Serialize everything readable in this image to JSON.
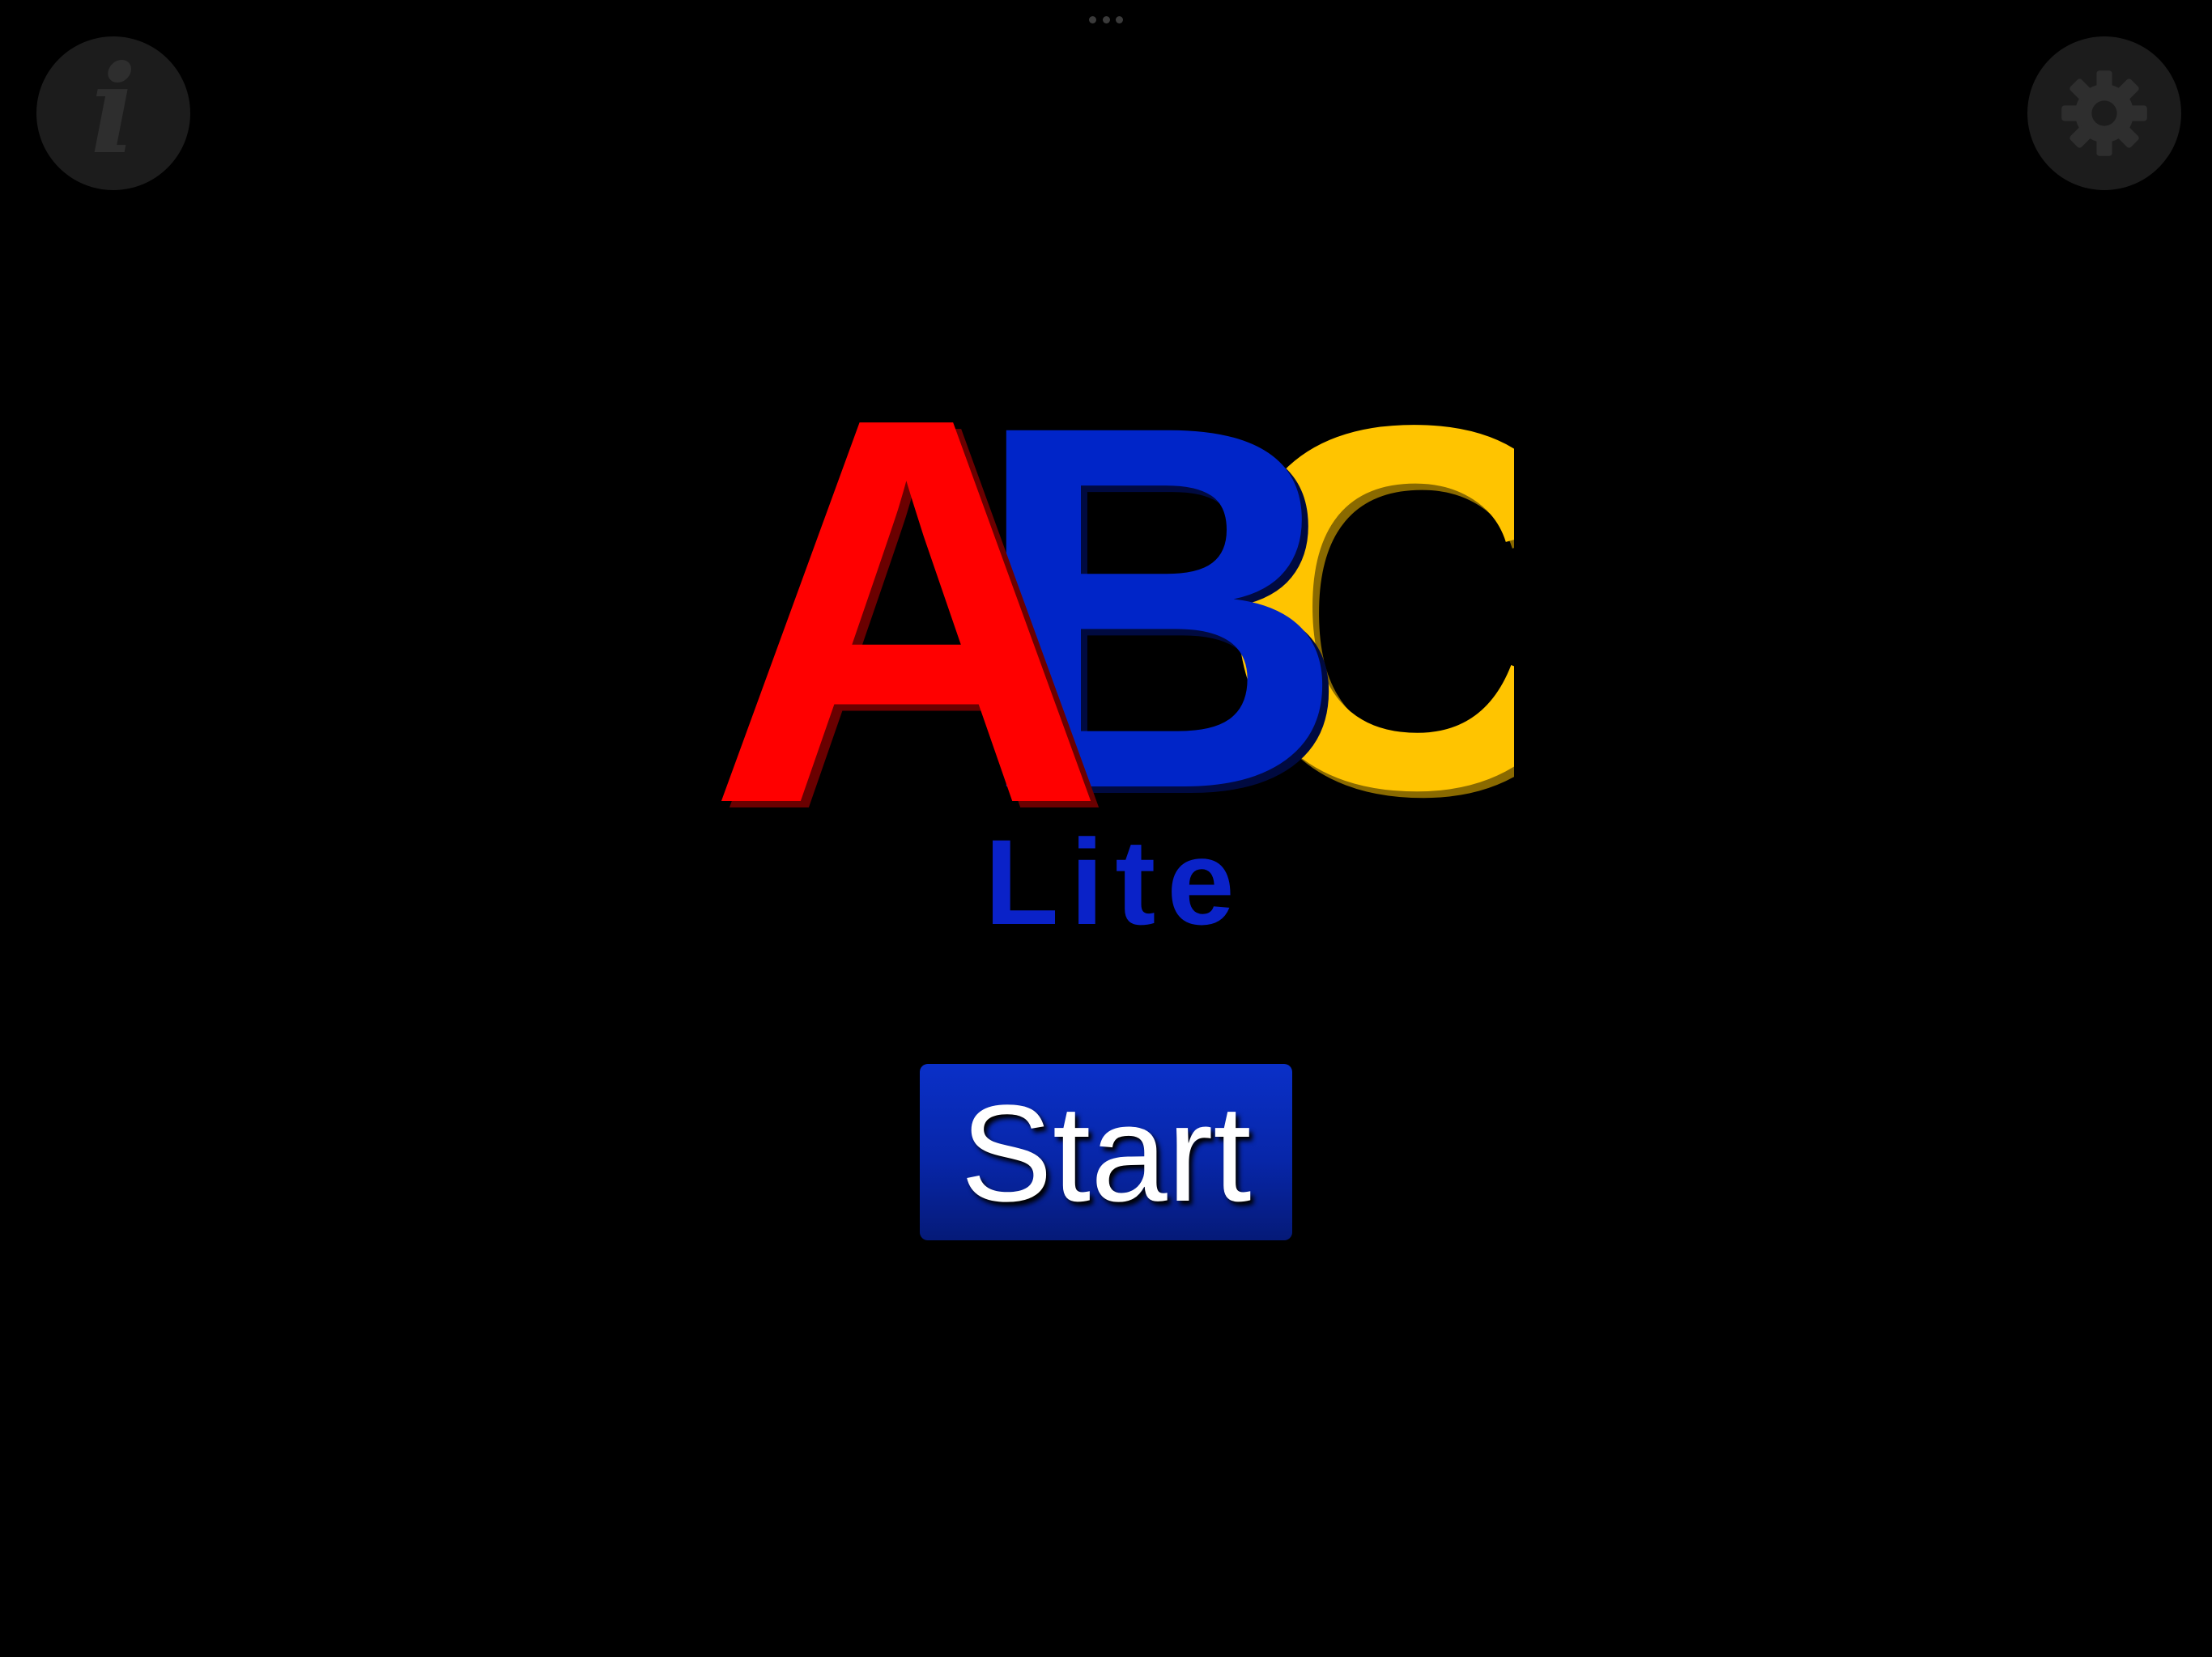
{
  "app": {
    "logo_text": "ABC",
    "logo_letters": [
      {
        "letter": "A",
        "color": "#ff0000"
      },
      {
        "letter": "B",
        "color": "#0025c8"
      },
      {
        "letter": "C",
        "color": "#ffc400"
      }
    ],
    "subtitle": "Lite",
    "start_label": "Start"
  },
  "toolbar": {
    "info_icon": "info-icon",
    "info_glyph": "i",
    "settings_icon": "gear-icon"
  },
  "colors": {
    "background": "#000000",
    "button_circle": "#1c1c1c",
    "icon_gray": "#2e2e2e",
    "subtitle_blue": "#0a22c8",
    "start_button_blue": "#0726a8"
  }
}
